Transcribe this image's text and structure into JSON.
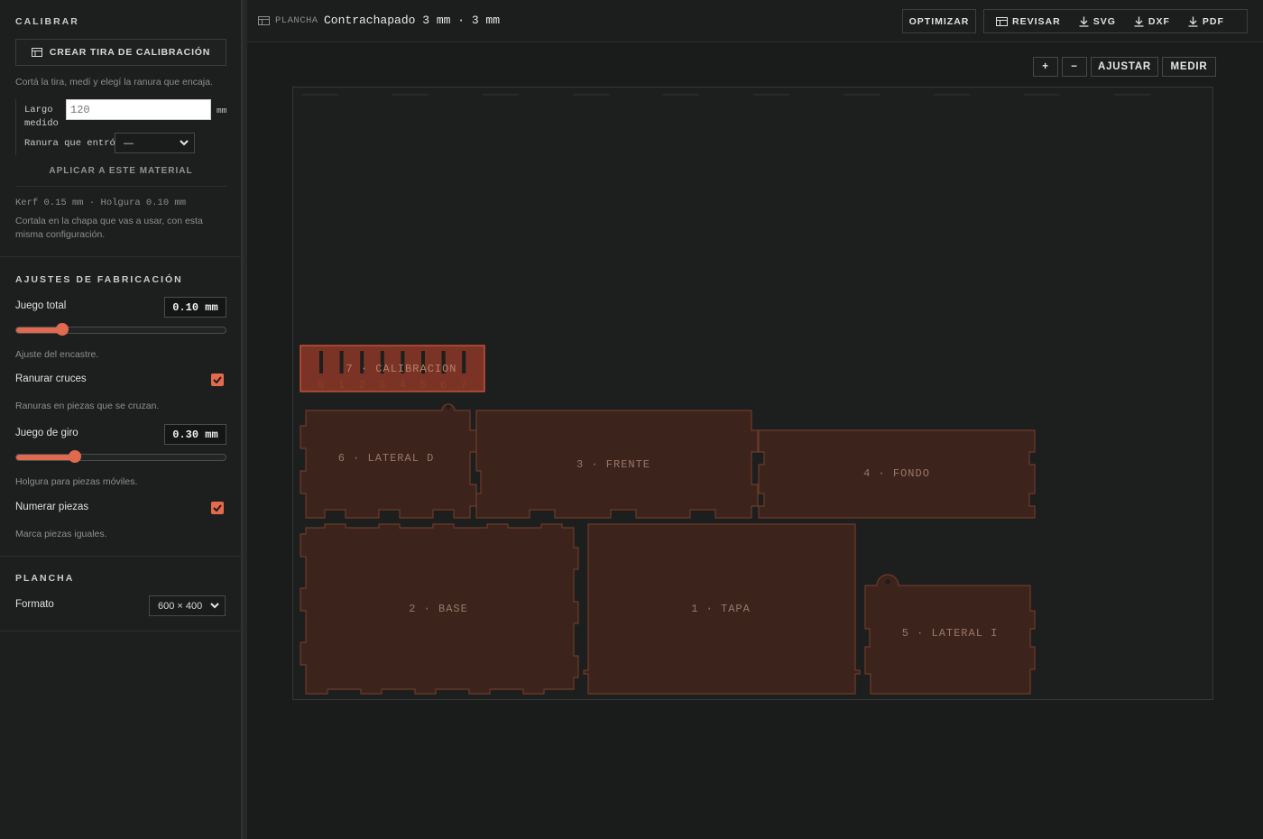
{
  "sidebar": {
    "calibrar": {
      "title": "CALIBRAR",
      "strip_button": "CREAR TIRA DE CALIBRACIÓN",
      "hint": "Cortá la tira, medí y elegí la ranura que encaja.",
      "largo_label_1": "Largo",
      "largo_label_2": "medido",
      "largo_placeholder": "120",
      "unit": "mm",
      "ranura_label": "Ranura que entró",
      "ranura_value": "—",
      "apply": "APLICAR A ESTE MATERIAL",
      "status": "Kerf 0.15 mm · Holgura 0.10 mm",
      "note_1": "Cortala en la chapa que vas a usar, con esta",
      "note_2": "misma configuración."
    },
    "ajustes": {
      "title": "AJUSTES DE FABRICACIÓN",
      "juego_total_label": "Juego total",
      "juego_total_value": "0.10 mm",
      "juego_total_fraction": 0.22,
      "juego_total_desc": "Ajuste del encastre.",
      "ranurar_label": "Ranurar cruces",
      "ranurar_checked": true,
      "ranurar_desc": "Ranuras en piezas que se cruzan.",
      "juego_giro_label": "Juego de giro",
      "juego_giro_value": "0.30 mm",
      "juego_giro_fraction": 0.28,
      "juego_giro_desc": "Holgura para piezas móviles.",
      "numerar_label": "Numerar piezas",
      "numerar_checked": true,
      "numerar_desc": "Marca piezas iguales."
    },
    "plancha": {
      "title": "PLANCHA",
      "formato_label": "Formato",
      "formato_value": "600 × 400"
    }
  },
  "toolbar": {
    "sheet_label": "PLANCHA",
    "sheet_name": "Contrachapado 3 mm · 3 mm",
    "optimizar": "OPTIMIZAR",
    "revisar": "REVISAR",
    "svg": "SVG",
    "dxf": "DXF",
    "pdf": "PDF"
  },
  "canvas": {
    "zoom_in": "+",
    "zoom_out": "−",
    "ajustar": "AJUSTAR",
    "medir": "MEDIR",
    "calibration_digits": [
      "0",
      "1",
      "2",
      "3",
      "4",
      "5",
      "6",
      "7"
    ],
    "pieces": {
      "calibracion": "7 · CALIBRACION",
      "lateral_d": "6 · LATERAL D",
      "frente": "3 · FRENTE",
      "fondo": "4 · FONDO",
      "base": "2 · BASE",
      "tapa": "1 · TAPA",
      "lateral_i": "5 · LATERAL I"
    }
  },
  "colors": {
    "accent": "#e06a4f",
    "piece_fill": "#3c241d",
    "piece_stroke": "#6e3a2a",
    "calib_fill": "#7a3324",
    "calib_stroke": "#d4563a"
  }
}
